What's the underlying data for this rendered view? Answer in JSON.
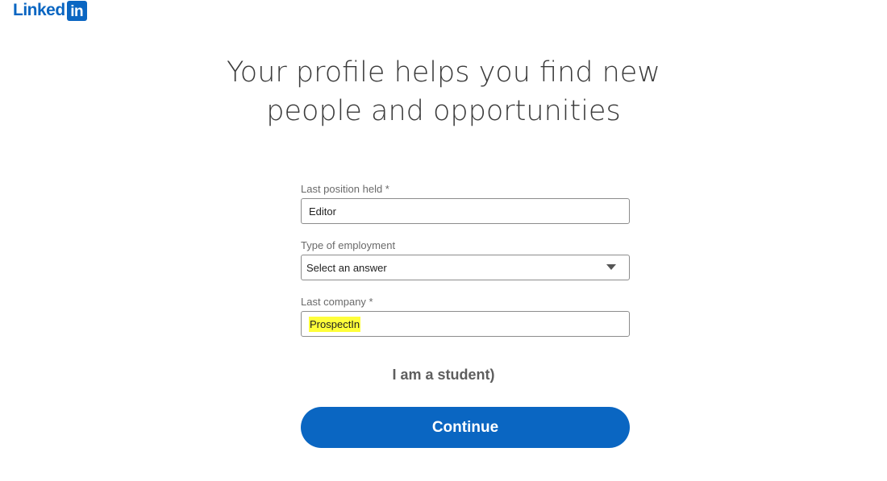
{
  "brand": {
    "wordmark": "Linked",
    "box_text": "in",
    "color": "#0a66c2"
  },
  "headline": {
    "line1": "Your profile helps you find new",
    "line2": "people and opportunities"
  },
  "form": {
    "position": {
      "label": "Last position held *",
      "value": "Editor"
    },
    "employment_type": {
      "label": "Type of employment",
      "selected": "Select an answer"
    },
    "company": {
      "label": "Last company *",
      "value": "ProspectIn",
      "highlight_color": "#ffff3a"
    }
  },
  "student_link": "I am a student)",
  "continue_label": "Continue",
  "colors": {
    "accent": "#0a66c2",
    "text_muted": "#6a6a6a"
  }
}
